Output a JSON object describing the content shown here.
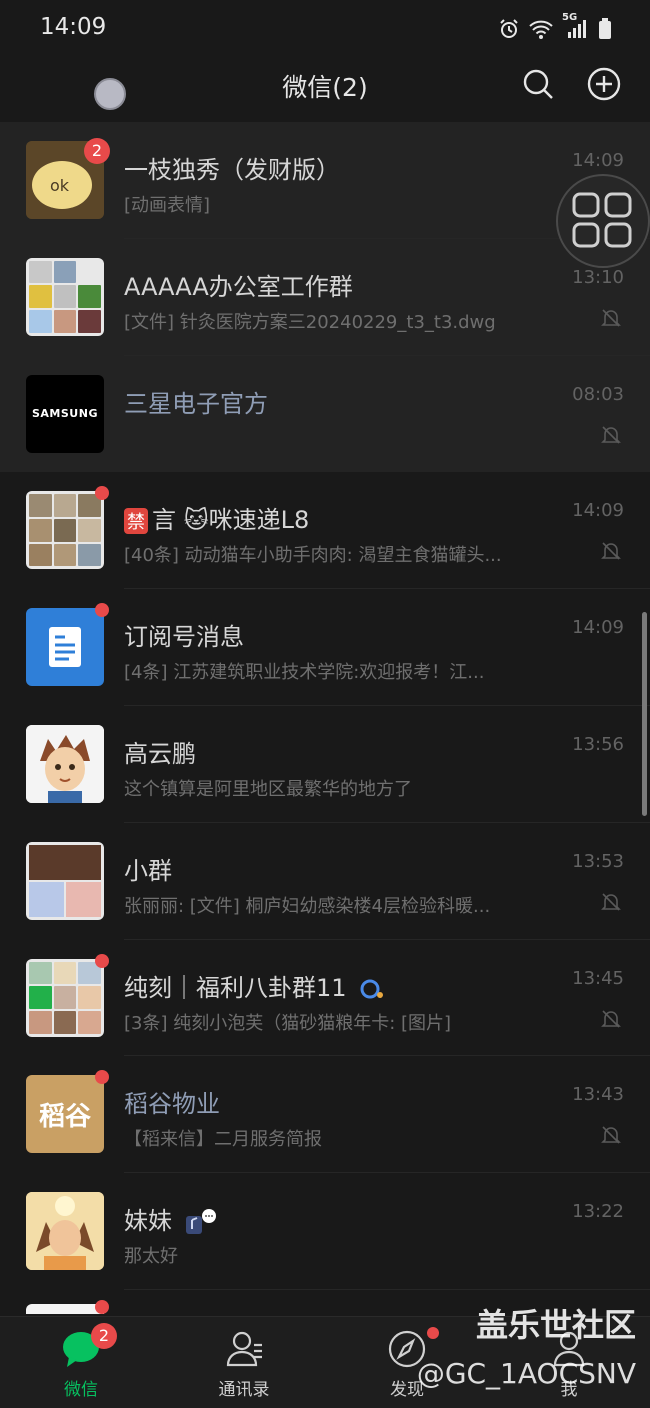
{
  "status_bar": {
    "time": "14:09",
    "network": "5G"
  },
  "header": {
    "title": "微信(2)"
  },
  "chats": [
    {
      "name": "一枝独秀（发财版）",
      "preview": "[动画表情]",
      "time": "14:09",
      "badge": "2",
      "muted": false,
      "pinned": true,
      "official": false,
      "avatar_color": "#b8904a"
    },
    {
      "name": "AAAAA办公室工作群",
      "preview": "[文件] 针灸医院方案三20240229_t3_t3.dwg",
      "time": "13:10",
      "muted": true,
      "pinned": true,
      "official": false
    },
    {
      "name": "三星电子官方",
      "preview": "",
      "time": "08:03",
      "muted": true,
      "pinned": true,
      "official": true,
      "avatar_text": "SAMSUNG"
    },
    {
      "name_prefix": "禁",
      "name": "言 🐱咪速递L8",
      "preview": "[40条] 动动猫车小助手肉肉: 渴望主食猫罐头...",
      "time": "14:09",
      "muted": true,
      "dot": true
    },
    {
      "name": "订阅号消息",
      "preview": "[4条] 江苏建筑职业技术学院:欢迎报考！江...",
      "time": "14:09",
      "muted": false,
      "dot": true,
      "avatar_color": "#2f7fd8"
    },
    {
      "name": "高云鹏",
      "preview": "这个镇算是阿里地区最繁华的地方了",
      "time": "13:56",
      "muted": false
    },
    {
      "name": "小群",
      "preview": "张丽丽: [文件] 桐庐妇幼感染楼4层检验科暖...",
      "time": "13:53",
      "muted": true
    },
    {
      "name": "纯刻｜福利八卦群11",
      "preview": "[3条] 纯刻小泡芙（猫砂猫粮年卡: [图片]",
      "time": "13:45",
      "muted": true,
      "dot": true
    },
    {
      "name": "稻谷物业",
      "preview": "【稻来信】二月服务简报",
      "time": "13:43",
      "muted": true,
      "dot": true,
      "official": true,
      "avatar_text": "稻谷",
      "avatar_color": "#c9a064"
    },
    {
      "name": "妹妹",
      "preview": "那太好",
      "time": "13:22",
      "muted": false
    }
  ],
  "tabs": [
    {
      "label": "微信",
      "badge": "2",
      "active": true
    },
    {
      "label": "通讯录"
    },
    {
      "label": "发现",
      "dot": true
    },
    {
      "label": "我"
    }
  ],
  "watermark": {
    "line1": "盖乐世社区",
    "line2": "@GC_1AOCSNV"
  },
  "colors": {
    "accent": "#07c160",
    "badge": "#e84a4a",
    "background": "#191919"
  }
}
